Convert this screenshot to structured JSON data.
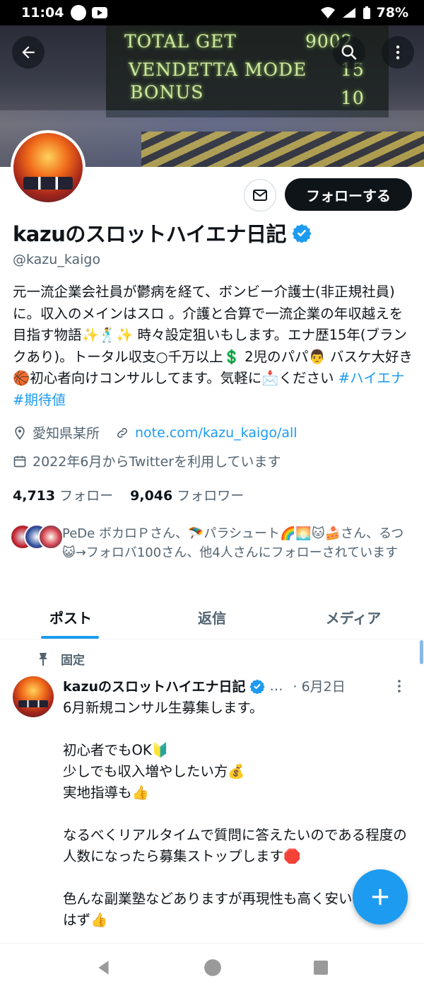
{
  "status_bar": {
    "time": "11:04",
    "battery": "78%"
  },
  "banner": {
    "line1": "TOTAL GET",
    "line1_value": "9002",
    "line2": "VENDETTA MODE",
    "line2_value": "15",
    "line3": "BONUS",
    "line3_value": "10"
  },
  "profile": {
    "follow_label": "フォローする",
    "display_name": "kazuのスロットハイエナ日記",
    "handle": "@kazu_kaigo",
    "bio": "元一流企業会社員が鬱病を経て、ボンビー介護士(非正規社員)に。収入のメインはスロ 。介護と合算で一流企業の年収越えを目指す物語✨🕺✨ 時々設定狙いもします。エナ歴15年(ブランクあり)。トータル収支○千万以上💲 2児のパパ👨 バスケ大好き🏀初心者向けコンサルしてます。気軽に📩ください ",
    "bio_tag1": "#ハイエナ",
    "bio_tag2": "#期待値",
    "location": "愛知県某所",
    "link": "note.com/kazu_kaigo/all",
    "joined": "2022年6月からTwitterを利用しています",
    "following_count": "4,713",
    "following_label": "フォロー",
    "followers_count": "9,046",
    "followers_label": "フォロワー",
    "followed_by": "PeDe ボカロＰさん、🪂パラシュート🌈🌅🐱🍰さん、るつ😺→フォロバ100さん、他4人さんにフォローされています"
  },
  "tabs": [
    {
      "label": "ポスト"
    },
    {
      "label": "返信"
    },
    {
      "label": "メディア"
    }
  ],
  "pinned_post": {
    "pinned_label": "固定",
    "author": "kazuのスロットハイエナ日記",
    "ellipsis": "…",
    "date": "· 6月2日",
    "text": "6月新規コンサル生募集します。\n\n初心者でもOK🔰\n少しでも収入増やしたい方💰\n実地指導も👍\n\nなるべくリアルタイムで質問に答えたいのである程度の人数になったら募集ストップします🛑\n\n色んな副業塾などありますが再現性も高く安いと思えるはず👍"
  },
  "icons": {
    "back": "arrow-left-icon",
    "search": "search-icon",
    "more": "more-vertical-icon",
    "mail": "mail-icon",
    "verified": "verified-badge-icon",
    "location": "location-pin-icon",
    "link": "link-icon",
    "calendar": "calendar-icon",
    "pin": "pin-icon",
    "compose": "plus-icon"
  },
  "colors": {
    "accent": "#1d9bf0",
    "text": "#0f1419",
    "muted": "#536471"
  }
}
